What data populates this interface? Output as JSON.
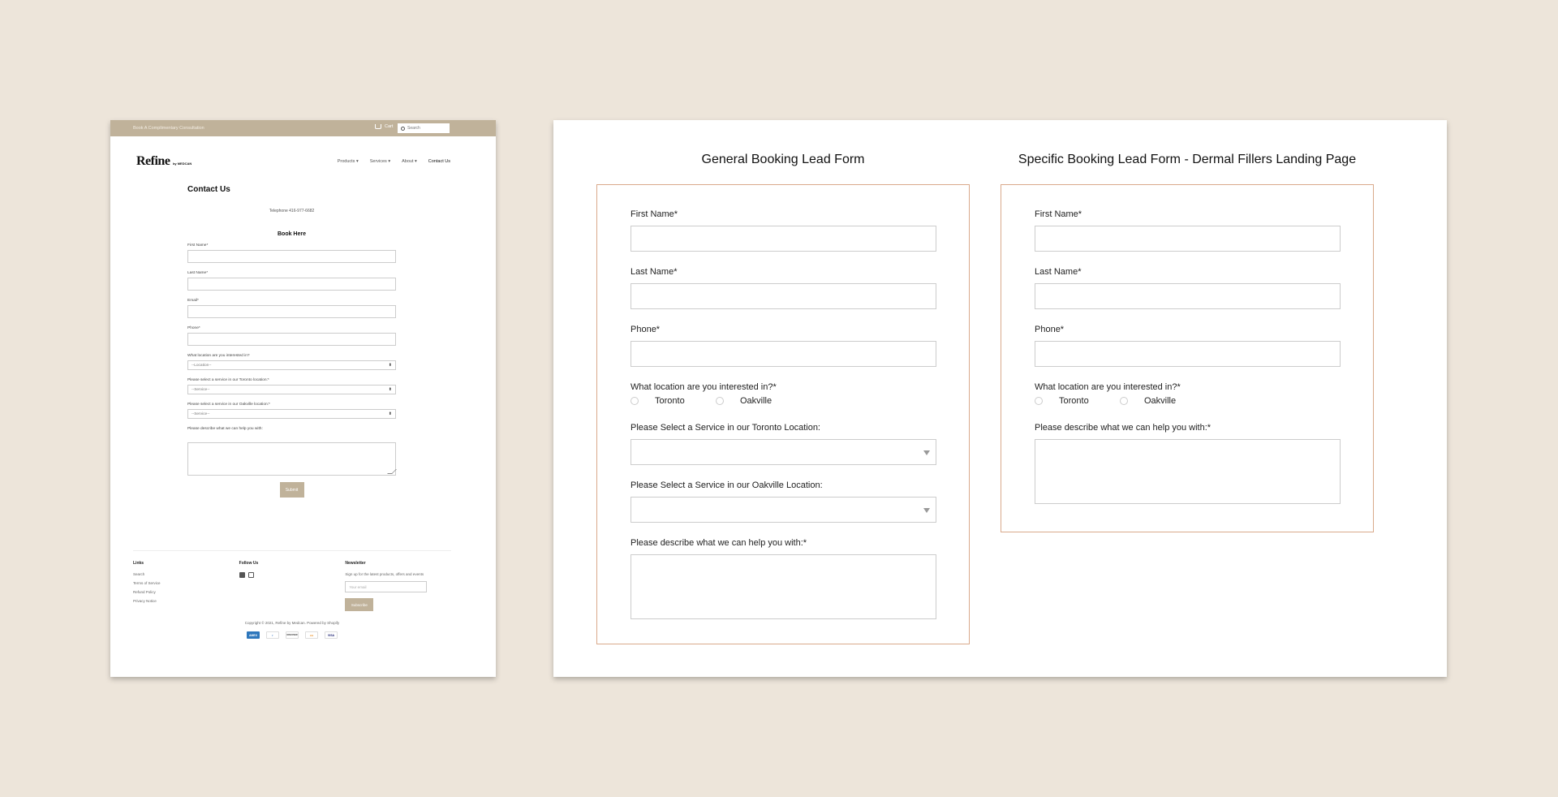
{
  "site": {
    "topbar": {
      "link": "Book A Complimentary Consultation",
      "cart_label": "Cart",
      "search_placeholder": "Search"
    },
    "logo": {
      "name": "Refine",
      "sub": "by MEDCAN"
    },
    "nav": [
      "Products ▾",
      "Services ▾",
      "About ▾",
      "Contact Us"
    ],
    "content": {
      "title": "Contact Us",
      "phone": "Telephone 416-977-6682",
      "book_title": "Book Here",
      "fields": [
        "First Name*",
        "Last Name*",
        "Email*",
        "Phone*"
      ],
      "location_label": "What location are you interested in?",
      "location_value": "--Location--",
      "toronto_label": "Please select a service in our Toronto location:*",
      "toronto_value": "--Service--",
      "oakville_label": "Please select a service in our Oakville location:*",
      "oakville_value": "--Service--",
      "describe_label": "Please describe what we can help you with:",
      "submit": "Submit"
    },
    "footer": {
      "links_head": "Links",
      "links": [
        "Search",
        "Terms of Service",
        "Refund Policy",
        "Privacy Notice"
      ],
      "follow_head": "Follow Us",
      "newsletter_head": "Newsletter",
      "newsletter_text": "Sign up for the latest products, offers and events",
      "email_placeholder": "Your email",
      "subscribe": "Subscribe",
      "copyright": "Copyright © 2021, Refine by Medcan. Powered by Shopify",
      "payments": [
        {
          "label": "AMEX",
          "color": "#2e77bc"
        },
        {
          "label": "◐",
          "color": "#ffffff"
        },
        {
          "label": "DISCOVER",
          "color": "#ffffff"
        },
        {
          "label": "●●",
          "color": "#ffffff"
        },
        {
          "label": "VISA",
          "color": "#ffffff"
        }
      ]
    }
  },
  "compare": {
    "general": {
      "title": "General Booking Lead Form",
      "first_name": "First Name*",
      "last_name": "Last Name*",
      "phone": "Phone*",
      "location": "What location are you interested in?*",
      "toronto": "Toronto",
      "oakville": "Oakville",
      "toronto_service": "Please Select a Service in our Toronto Location:",
      "oakville_service": "Please Select a Service in our Oakville Location:",
      "describe": "Please describe what we can help you with:*"
    },
    "specific": {
      "title": "Specific Booking Lead Form - Dermal Fillers Landing Page",
      "first_name": "First Name*",
      "last_name": "Last Name*",
      "phone": "Phone*",
      "location": "What location are you interested in?*",
      "toronto": "Toronto",
      "oakville": "Oakville",
      "describe": "Please describe what we can help you with:*"
    },
    "border_color": "#d9a98b"
  }
}
